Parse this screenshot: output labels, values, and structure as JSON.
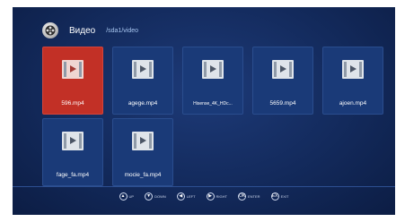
{
  "header": {
    "title": "Видео",
    "path": "/sda1/video"
  },
  "files": [
    {
      "name": "596.mp4",
      "selected": true
    },
    {
      "name": "agege.mp4",
      "selected": false
    },
    {
      "name": "Hisense_4K_HDc...",
      "selected": false
    },
    {
      "name": "5659.mp4",
      "selected": false
    },
    {
      "name": "ajoen.mp4",
      "selected": false
    },
    {
      "name": "fage_fa.mp4",
      "selected": false
    },
    {
      "name": "mocie_fa.mp4",
      "selected": false
    }
  ],
  "footer": {
    "hints": [
      {
        "key": "▲",
        "label": "UP",
        "icon": "up-arrow-icon"
      },
      {
        "key": "▼",
        "label": "DOWN",
        "icon": "down-arrow-icon"
      },
      {
        "key": "◀",
        "label": "LEFT",
        "icon": "left-arrow-icon"
      },
      {
        "key": "▶",
        "label": "RIGHT",
        "icon": "right-arrow-icon"
      },
      {
        "key": "OK",
        "label": "ENTER",
        "icon": "enter-icon"
      },
      {
        "key": "EX",
        "label": "EXIT",
        "icon": "exit-icon"
      }
    ]
  },
  "colors": {
    "background": "#132a5c",
    "tile": "#1a3a78",
    "selected_tile": "#c23026"
  }
}
